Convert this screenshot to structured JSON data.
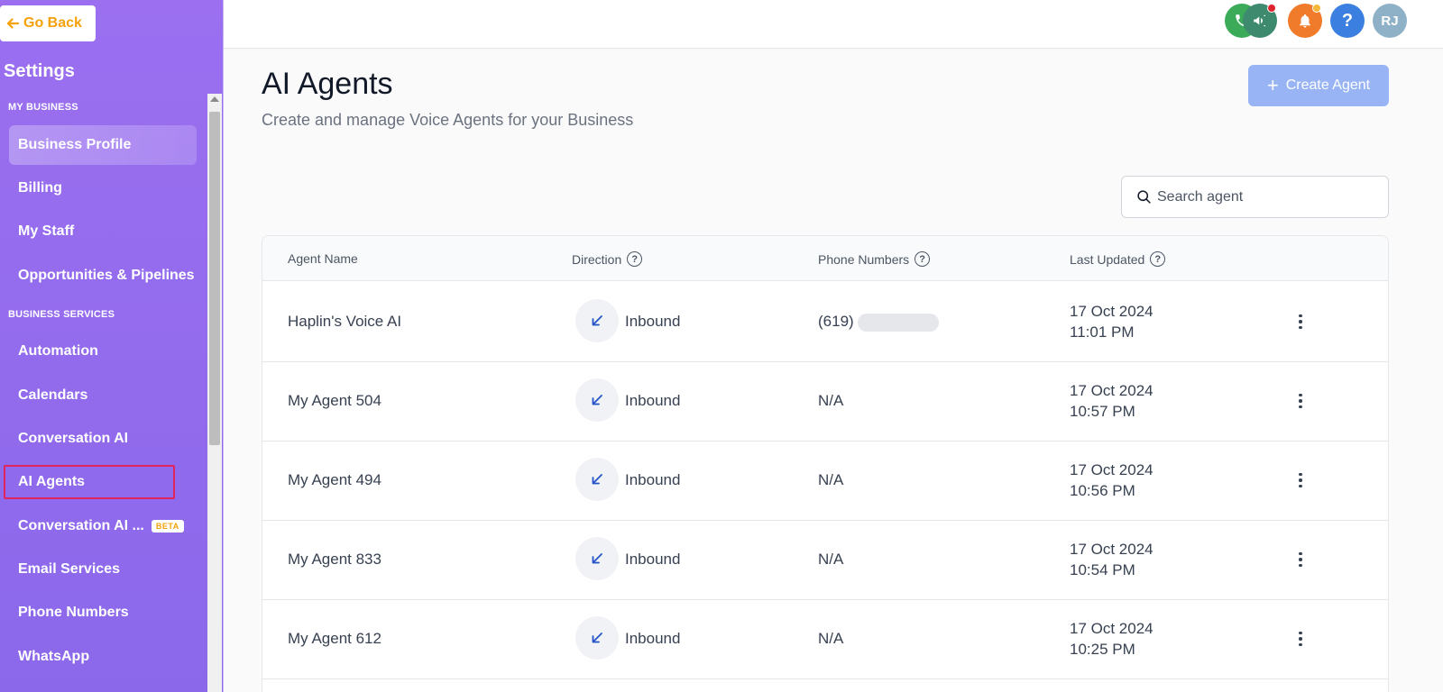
{
  "sidebar": {
    "go_back": "Go Back",
    "title": "Settings",
    "sections": [
      {
        "label": "MY BUSINESS"
      },
      {
        "label": "BUSINESS SERVICES"
      }
    ],
    "items": [
      {
        "label": "Business Profile"
      },
      {
        "label": "Billing"
      },
      {
        "label": "My Staff"
      },
      {
        "label": "Opportunities & Pipelines"
      },
      {
        "label": "Automation"
      },
      {
        "label": "Calendars"
      },
      {
        "label": "Conversation AI"
      },
      {
        "label": "AI Agents"
      },
      {
        "label": "Conversation AI ...",
        "badge": "BETA"
      },
      {
        "label": "Email Services"
      },
      {
        "label": "Phone Numbers"
      },
      {
        "label": "WhatsApp"
      }
    ]
  },
  "topbar": {
    "icons": [
      "phone-icon",
      "megaphone-icon",
      "bell-icon",
      "help-icon"
    ],
    "avatar_initials": "RJ",
    "colors": {
      "phone": "#3bab5a",
      "megaphone": "#3d8a6e",
      "bell": "#f07b2a",
      "help": "#3b7fe0",
      "avatar": "#8fb1c7"
    }
  },
  "main": {
    "title": "AI Agents",
    "subtitle": "Create and manage Voice Agents for your Business",
    "create_button": "Create Agent",
    "search_placeholder": "Search agent",
    "columns": [
      "Agent Name",
      "Direction",
      "Phone Numbers",
      "Last Updated"
    ],
    "rows": [
      {
        "name": "Haplin's Voice AI",
        "direction": "Inbound",
        "phone": "(619)",
        "date": "17 Oct 2024",
        "time": "11:01 PM"
      },
      {
        "name": "My Agent 504",
        "direction": "Inbound",
        "phone": "N/A",
        "date": "17 Oct 2024",
        "time": "10:57 PM"
      },
      {
        "name": "My Agent 494",
        "direction": "Inbound",
        "phone": "N/A",
        "date": "17 Oct 2024",
        "time": "10:56 PM"
      },
      {
        "name": "My Agent 833",
        "direction": "Inbound",
        "phone": "N/A",
        "date": "17 Oct 2024",
        "time": "10:54 PM"
      },
      {
        "name": "My Agent 612",
        "direction": "Inbound",
        "phone": "N/A",
        "date": "17 Oct 2024",
        "time": "10:25 PM"
      }
    ]
  },
  "colors": {
    "sidebar": "#9b6ff0",
    "accent": "#f5a10a",
    "button": "#98b4f5",
    "direction_icon": "#2453c7"
  }
}
